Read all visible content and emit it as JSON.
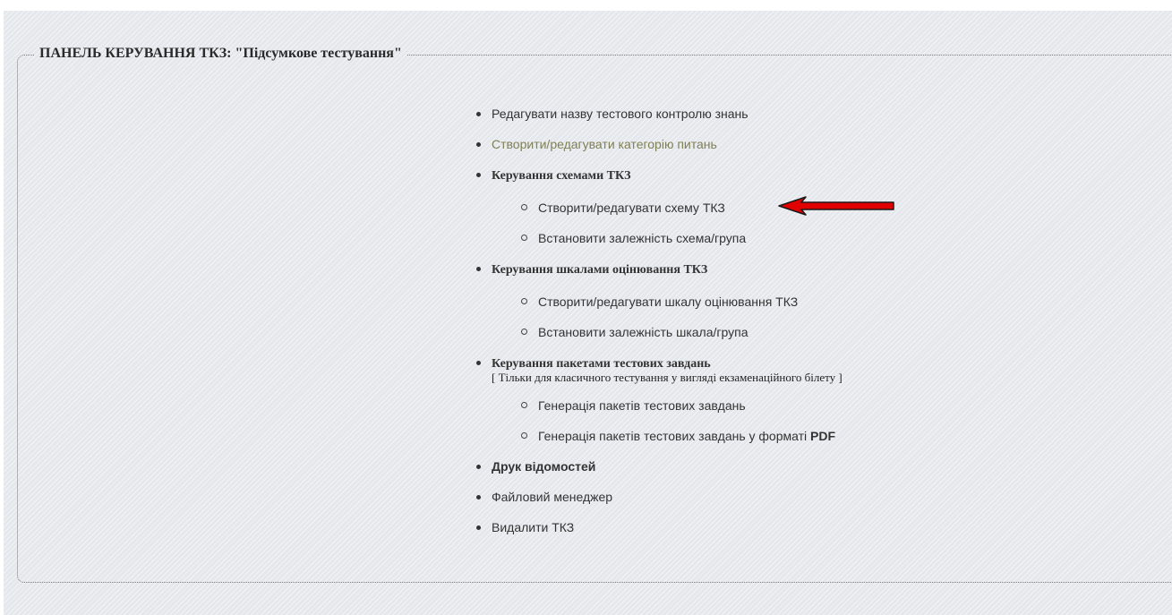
{
  "panel": {
    "title": "ПАНЕЛЬ КЕРУВАННЯ ТКЗ: \"Підсумкове тестування\""
  },
  "menu": {
    "edit_name": "Редагувати назву тестового контролю знань",
    "edit_category": "Створити/редагувати категорію питань",
    "schemes": {
      "label": "Керування схемами ТКЗ",
      "items": [
        "Створити/редагувати схему ТКЗ",
        "Встановити залежність схема/група"
      ]
    },
    "scales": {
      "label": "Керування шкалами оцінювання ТКЗ",
      "items": [
        "Створити/редагувати шкалу оцінювання ТКЗ",
        "Встановити залежність шкала/група"
      ]
    },
    "packages": {
      "label": "Керування пакетами тестових завдань",
      "note": "[ Тільки для класичного тестування у вигляді екзаменаційного білету ]",
      "items": [
        "Генерація пакетів тестових завдань",
        "Генерація пакетів тестових завдань у форматі "
      ],
      "pdf_label": "PDF"
    },
    "print_statements": "Друк відомостей",
    "file_manager": "Файловий менеджер",
    "delete_tkz": "Видалити ТКЗ"
  },
  "annotation": {
    "arrow_color": "#e00000",
    "icon": "red-arrow-icon"
  }
}
